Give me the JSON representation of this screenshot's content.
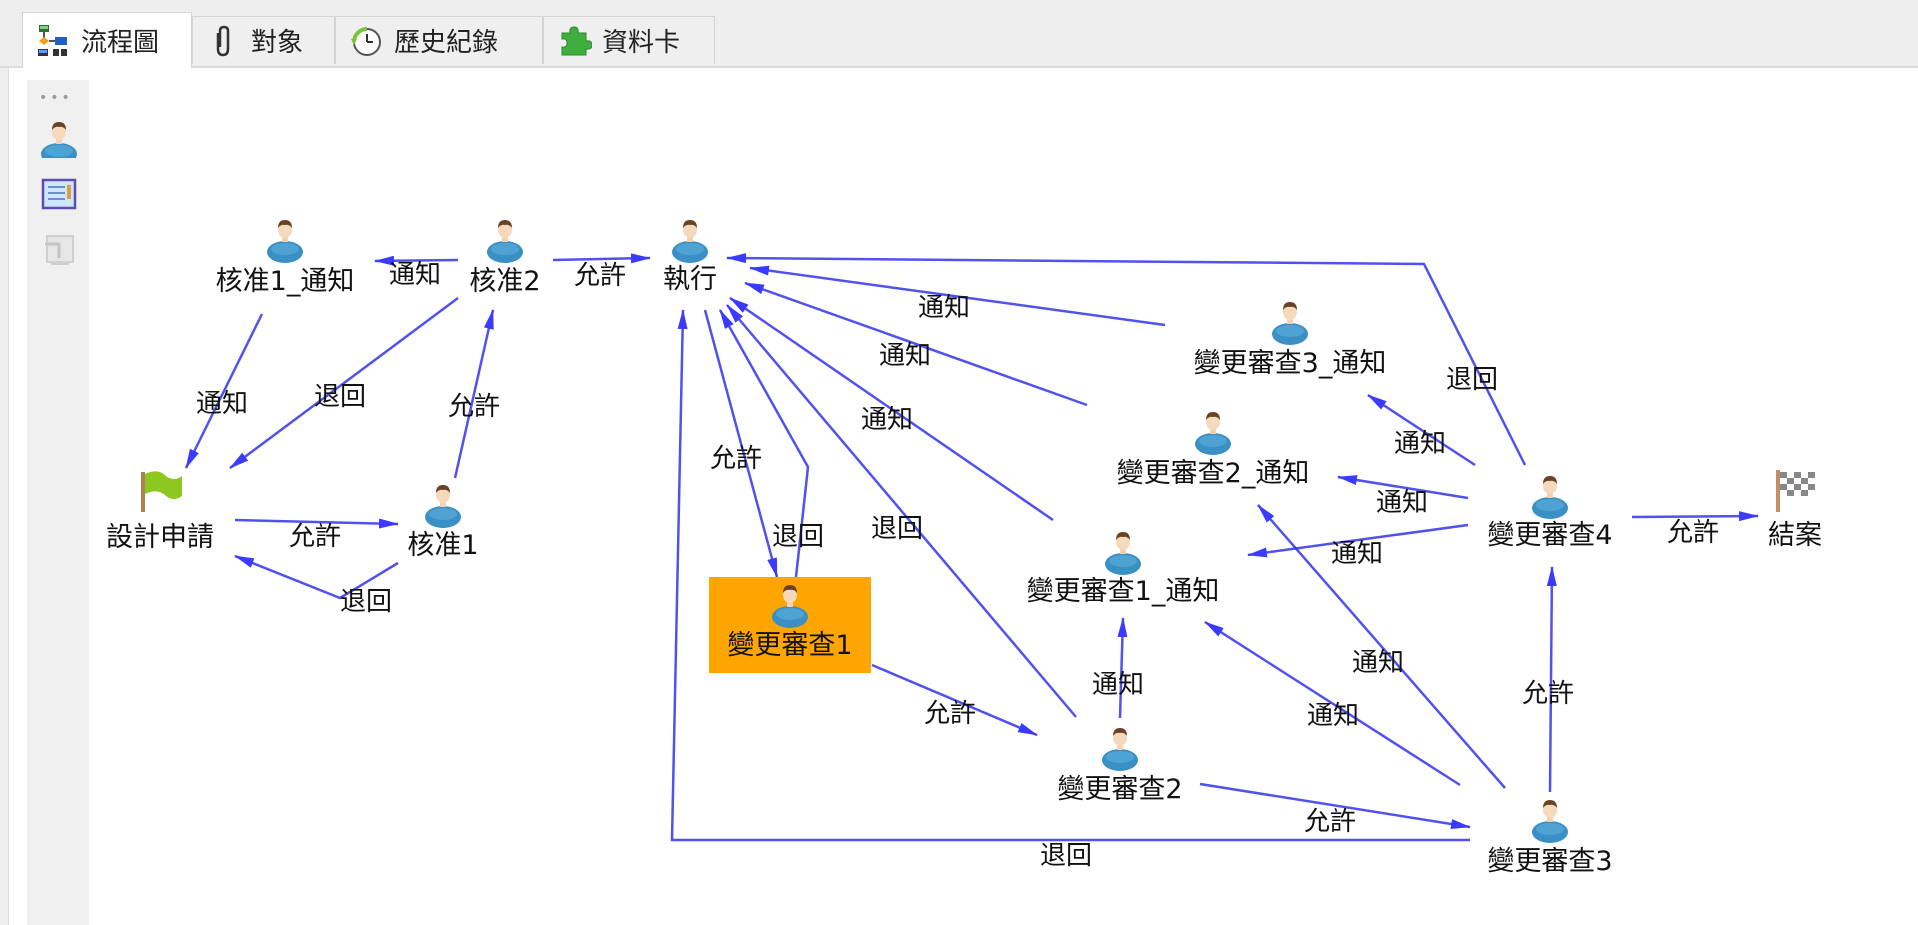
{
  "tabs": [
    {
      "label": "流程圖",
      "icon": "flowchart-icon",
      "active": true
    },
    {
      "label": "對象",
      "icon": "paperclip-icon",
      "active": false
    },
    {
      "label": "歷史紀錄",
      "icon": "clock-history-icon",
      "active": false
    },
    {
      "label": "資料卡",
      "icon": "puzzle-icon",
      "active": false
    }
  ],
  "palette": {
    "items": [
      {
        "name": "user-node-tool",
        "icon": "person-icon"
      },
      {
        "name": "form-tool",
        "icon": "notebook-icon"
      },
      {
        "name": "connector-tool",
        "icon": "connector-icon"
      }
    ]
  },
  "flow": {
    "highlight_color": "#FFA500",
    "edge_color": "#3333EE",
    "nodes": [
      {
        "id": "design_req",
        "label": "設計申請",
        "type": "start"
      },
      {
        "id": "approve1_notify",
        "label": "核准1_通知",
        "type": "user"
      },
      {
        "id": "approve2",
        "label": "核准2",
        "type": "user"
      },
      {
        "id": "execute",
        "label": "執行",
        "type": "user"
      },
      {
        "id": "approve1",
        "label": "核准1",
        "type": "user"
      },
      {
        "id": "review1",
        "label": "變更審查1",
        "type": "user",
        "active": true
      },
      {
        "id": "review1_notify",
        "label": "變更審查1_通知",
        "type": "user"
      },
      {
        "id": "review2_notify",
        "label": "變更審查2_通知",
        "type": "user"
      },
      {
        "id": "review3_notify",
        "label": "變更審查3_通知",
        "type": "user"
      },
      {
        "id": "review2",
        "label": "變更審查2",
        "type": "user"
      },
      {
        "id": "review3",
        "label": "變更審查3",
        "type": "user"
      },
      {
        "id": "review4",
        "label": "變更審查4",
        "type": "user"
      },
      {
        "id": "close",
        "label": "結案",
        "type": "end"
      }
    ],
    "edges": [
      {
        "from": "design_req",
        "to": "approve1",
        "label": "允許"
      },
      {
        "from": "approve1",
        "to": "design_req",
        "label": "退回"
      },
      {
        "from": "approve1",
        "to": "approve2",
        "label": "允許"
      },
      {
        "from": "approve2",
        "to": "design_req",
        "label": "退回"
      },
      {
        "from": "approve2",
        "to": "approve1_notify",
        "label": "通知"
      },
      {
        "from": "approve1_notify",
        "to": "design_req",
        "label": "通知"
      },
      {
        "from": "approve2",
        "to": "execute",
        "label": "允許"
      },
      {
        "from": "execute",
        "to": "review1",
        "label": "允許"
      },
      {
        "from": "review1",
        "to": "execute",
        "label": "退回"
      },
      {
        "from": "review1",
        "to": "review2",
        "label": "允許"
      },
      {
        "from": "review2",
        "to": "execute",
        "label": "退回"
      },
      {
        "from": "review1_notify",
        "to": "execute",
        "label": "通知"
      },
      {
        "from": "review2_notify",
        "to": "execute",
        "label": "通知"
      },
      {
        "from": "review3_notify",
        "to": "execute",
        "label": "通知"
      },
      {
        "from": "review2",
        "to": "review1_notify",
        "label": "通知"
      },
      {
        "from": "review2",
        "to": "review3",
        "label": "允許"
      },
      {
        "from": "review3",
        "to": "execute",
        "label": "退回"
      },
      {
        "from": "review3",
        "to": "review1_notify",
        "label": "通知"
      },
      {
        "from": "review3",
        "to": "review2_notify",
        "label": "通知"
      },
      {
        "from": "review3",
        "to": "review4",
        "label": "允許"
      },
      {
        "from": "review4",
        "to": "review1_notify",
        "label": "通知"
      },
      {
        "from": "review4",
        "to": "review2_notify",
        "label": "通知"
      },
      {
        "from": "review4",
        "to": "review3_notify",
        "label": "通知"
      },
      {
        "from": "review4",
        "to": "execute",
        "label": "退回"
      },
      {
        "from": "review4",
        "to": "close",
        "label": "允許"
      }
    ]
  }
}
